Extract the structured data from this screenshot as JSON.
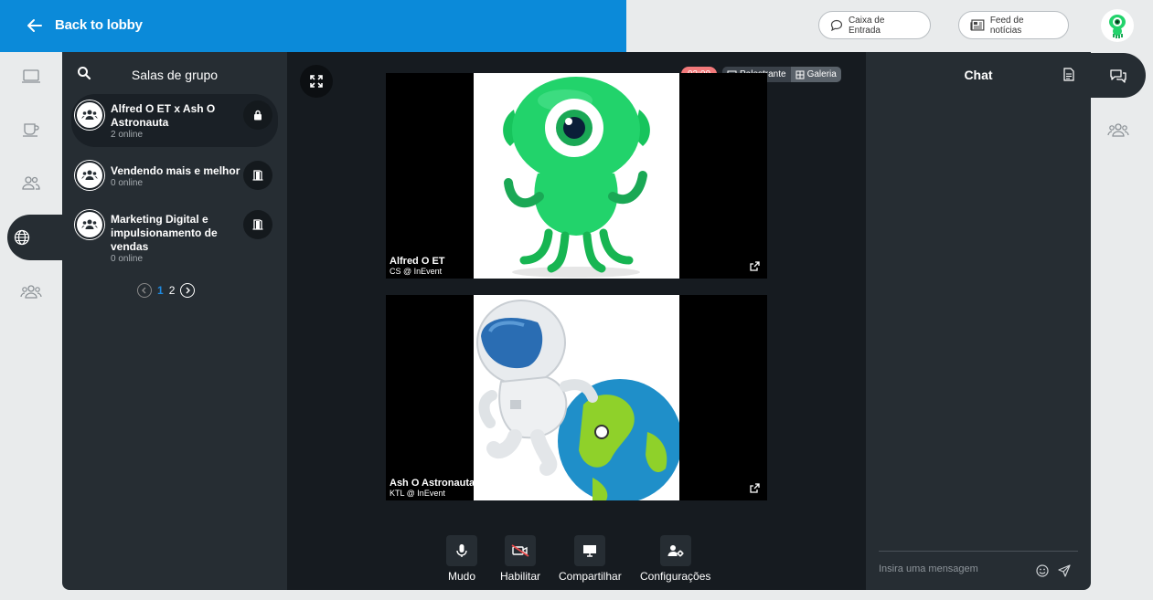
{
  "header": {
    "back_label": "Back to lobby",
    "inbox_label": "Caixa de Entrada",
    "news_label": "Feed de notícias"
  },
  "rooms": {
    "title": "Salas de grupo",
    "items": [
      {
        "name": "Alfred O ET x Ash O Astronauta",
        "online": "2 online"
      },
      {
        "name": "Vendendo mais e melhor",
        "online": "0 online"
      },
      {
        "name": "Marketing Digital e impulsionamento de vendas",
        "online": "0 online"
      }
    ],
    "pager": {
      "current": "1",
      "next": "2"
    }
  },
  "stage": {
    "timer": "02:00",
    "view_speaker": "Palestrante",
    "view_gallery": "Galeria",
    "tiles": [
      {
        "name": "Alfred O ET",
        "sub": "CS @ InEvent"
      },
      {
        "name": "Ash O Astronauta",
        "sub": "KTL @ InEvent"
      }
    ],
    "controls": {
      "mute": "Mudo",
      "enable": "Habilitar",
      "share": "Compartilhar",
      "settings": "Configurações"
    }
  },
  "chat": {
    "title": "Chat",
    "placeholder": "Insira uma mensagem"
  },
  "colors": {
    "brand_blue": "#0b8ad9",
    "panel": "#262d33",
    "stage": "#161b20",
    "timer": "#f2797a",
    "alien_green": "#22d36b"
  }
}
